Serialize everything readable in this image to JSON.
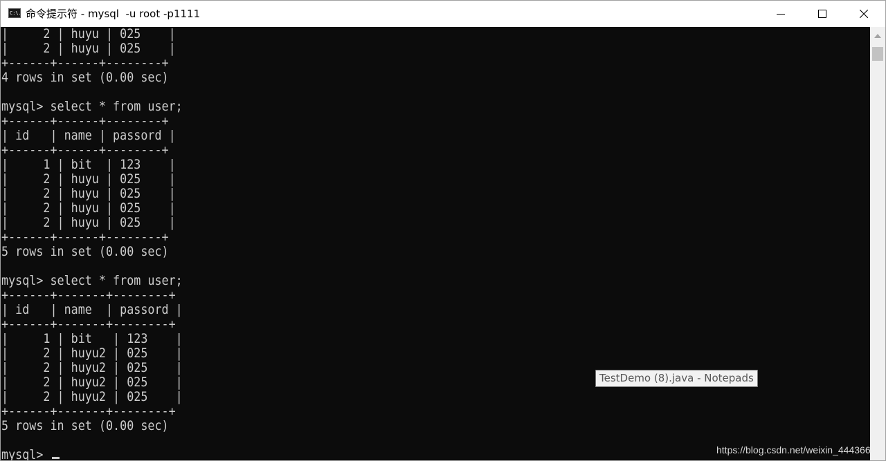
{
  "window": {
    "title": "命令提示符 - mysql  -u root -p1111",
    "icon": "cmd-icon",
    "icon_text": "C:\\."
  },
  "console": {
    "lines": [
      "|     2 | huyu | 025    |",
      "|     2 | huyu | 025    |",
      "+------+------+--------+",
      "4 rows in set (0.00 sec)",
      "",
      "mysql> select * from user;",
      "+------+------+--------+",
      "| id   | name | passord |",
      "+------+------+--------+",
      "|     1 | bit  | 123    |",
      "|     2 | huyu | 025    |",
      "|     2 | huyu | 025    |",
      "|     2 | huyu | 025    |",
      "|     2 | huyu | 025    |",
      "+------+------+--------+",
      "5 rows in set (0.00 sec)",
      "",
      "mysql> select * from user;",
      "+------+-------+--------+",
      "| id   | name  | passord |",
      "+------+-------+--------+",
      "|     1 | bit   | 123    |",
      "|     2 | huyu2 | 025    |",
      "|     2 | huyu2 | 025    |",
      "|     2 | huyu2 | 025    |",
      "|     2 | huyu2 | 025    |",
      "+------+-------+--------+",
      "5 rows in set (0.00 sec)",
      "",
      "mysql> "
    ]
  },
  "tooltip": {
    "text": "TestDemo (8).java - Notepads"
  },
  "watermark": {
    "text": "https://blog.csdn.net/weixin_444366"
  },
  "colors": {
    "console_background": "#0c0c0c",
    "console_text": "#cccccc",
    "titlebar_background": "#ffffff"
  }
}
